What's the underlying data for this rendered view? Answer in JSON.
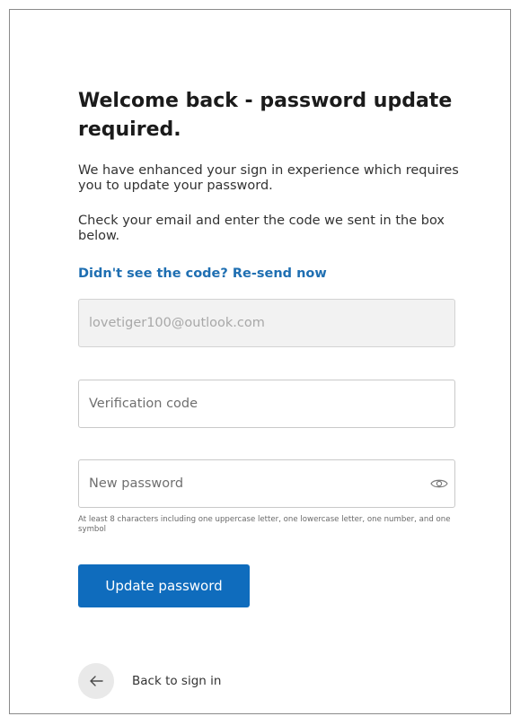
{
  "heading": "Welcome back - password update required.",
  "intro": "We have enhanced your sign in experience which requires you to update your password.",
  "instructions": "Check your email and enter the code we sent in the box below.",
  "resend_link": "Didn't see the code? Re-send now",
  "email_field": {
    "value": "lovetiger100@outlook.com"
  },
  "code_field": {
    "placeholder": "Verification code"
  },
  "password_field": {
    "placeholder": "New password",
    "toggle_icon": "eye-icon"
  },
  "password_hint": "At least 8 characters including one uppercase letter, one lowercase letter, one number, and one symbol",
  "submit_button": {
    "label": "Update password",
    "color": "#0f6cbd"
  },
  "back_link": {
    "label": "Back to sign in",
    "icon": "arrow-left-icon"
  },
  "colors": {
    "link": "#1f6fb2",
    "primary": "#0f6cbd"
  }
}
